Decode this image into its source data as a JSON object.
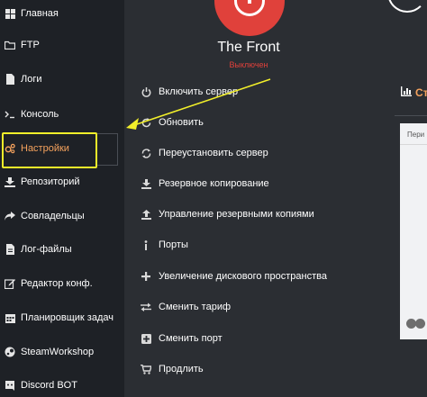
{
  "sidebar": {
    "items": [
      {
        "label": "Главная",
        "icon": "dashboard-icon"
      },
      {
        "label": "FTP",
        "icon": "folder-icon"
      },
      {
        "label": "Логи",
        "icon": "file-icon"
      },
      {
        "label": "Консоль",
        "icon": "terminal-icon"
      },
      {
        "label": "Настройки",
        "icon": "cogs-icon",
        "active": true
      },
      {
        "label": "Репозиторий",
        "icon": "download-icon"
      },
      {
        "label": "Совладельцы",
        "icon": "share-icon"
      },
      {
        "label": "Лог-файлы",
        "icon": "file-text-icon"
      },
      {
        "label": "Редактор конф.",
        "icon": "edit-icon"
      },
      {
        "label": "Планировщик задач",
        "icon": "calendar-icon"
      },
      {
        "label": "SteamWorkshop",
        "icon": "steam-icon"
      },
      {
        "label": "Discord BOT",
        "icon": "discord-icon"
      }
    ]
  },
  "server": {
    "name": "The Front",
    "status": "Выключен"
  },
  "actions": [
    {
      "label": "Включить сервер",
      "icon": "power-icon"
    },
    {
      "label": "Обновить",
      "icon": "refresh-icon"
    },
    {
      "label": "Переустановить сервер",
      "icon": "reinstall-icon"
    },
    {
      "label": "Резервное копирование",
      "icon": "backup-download-icon"
    },
    {
      "label": "Управление резервными копиями",
      "icon": "backup-upload-icon"
    },
    {
      "label": "Порты",
      "icon": "info-icon"
    },
    {
      "label": "Увеличение дискового пространства",
      "icon": "plus-icon"
    },
    {
      "label": "Сменить тариф",
      "icon": "exchange-icon"
    },
    {
      "label": "Сменить порт",
      "icon": "plus-square-icon"
    },
    {
      "label": "Продлить",
      "icon": "cart-icon"
    }
  ],
  "stats": {
    "title": "Ст",
    "panel_label": "Пери"
  },
  "colors": {
    "accent": "#f5a25d",
    "status_off": "#e0413b",
    "annotation": "#f2ef2a",
    "sidebar_bg": "#1e2126",
    "main_bg": "#2b2e33"
  }
}
